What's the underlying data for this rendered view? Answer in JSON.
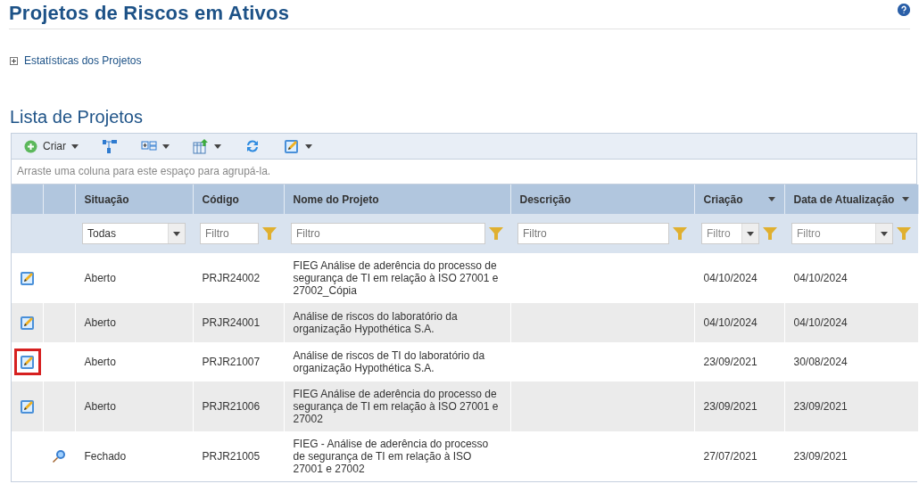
{
  "page_title": "Projetos de Riscos em Ativos",
  "stats_link": "Estatísticas dos Projetos",
  "list_title": "Lista de Projetos",
  "toolbar": {
    "create_label": "Criar"
  },
  "group_panel": "Arraste uma coluna para este espaço para agrupá-la.",
  "columns": [
    {
      "label": "Situação",
      "sortable": false
    },
    {
      "label": "Código",
      "sortable": false
    },
    {
      "label": "Nome do Projeto",
      "sortable": false
    },
    {
      "label": "Descrição",
      "sortable": false
    },
    {
      "label": "Criação",
      "sortable": true
    },
    {
      "label": "Data de Atualização",
      "sortable": true
    }
  ],
  "filters": [
    {
      "kind": "select",
      "value": "Todas"
    },
    {
      "kind": "text",
      "placeholder": "Filtro"
    },
    {
      "kind": "text",
      "placeholder": "Filtro"
    },
    {
      "kind": "text",
      "placeholder": "Filtro"
    },
    {
      "kind": "dropdown",
      "placeholder": "Filtro"
    },
    {
      "kind": "dropdown",
      "placeholder": "Filtro"
    }
  ],
  "rows": [
    {
      "kind": "edit",
      "highlighted": false,
      "status": "Aberto",
      "code": "PRJR24002",
      "name": "FIEG Análise de aderência do processo de segurança de TI em relação à ISO 27001 e 27002_Cópia",
      "created": "04/10/2024",
      "updated": "04/10/2024"
    },
    {
      "kind": "edit",
      "highlighted": false,
      "status": "Aberto",
      "code": "PRJR24001",
      "name": "Análise de riscos do laboratório da organização Hypothética S.A.",
      "created": "04/10/2024",
      "updated": "04/10/2024"
    },
    {
      "kind": "edit",
      "highlighted": true,
      "status": "Aberto",
      "code": "PRJR21007",
      "name": "Análise de riscos de TI do laboratório da organização Hypothética S.A.",
      "created": "23/09/2021",
      "updated": "30/08/2024"
    },
    {
      "kind": "edit",
      "highlighted": false,
      "status": "Aberto",
      "code": "PRJR21006",
      "name": "FIEG Análise de aderência do processo de segurança de TI em relação à ISO 27001 e 27002",
      "created": "23/09/2021",
      "updated": "23/09/2021"
    },
    {
      "kind": "view",
      "highlighted": false,
      "status": "Fechado",
      "code": "PRJR21005",
      "name": "FIEG - Análise de aderência do processo de segurança de TI em relação à ISO 27001 e 27002",
      "created": "27/07/2021",
      "updated": "23/09/2021"
    }
  ]
}
